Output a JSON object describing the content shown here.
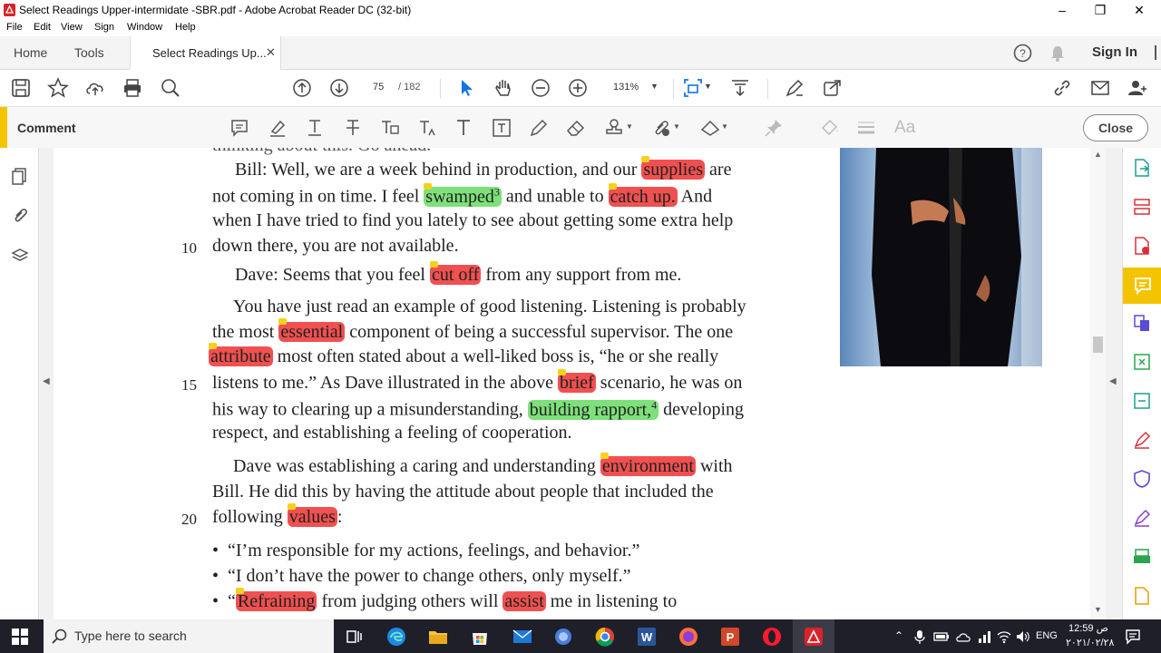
{
  "window": {
    "title": "Select Readings Upper-intermidate -SBR.pdf - Adobe Acrobat Reader DC (32-bit)"
  },
  "menu": [
    "File",
    "Edit",
    "View",
    "Sign",
    "Window",
    "Help"
  ],
  "tabs": {
    "home": "Home",
    "tools": "Tools",
    "document": "Select Readings Up..."
  },
  "header": {
    "sign_in": "Sign In"
  },
  "toolbar": {
    "page_current": "75",
    "page_total": "/ 182",
    "zoom": "131%"
  },
  "comment_bar": {
    "label": "Comment",
    "close": "Close",
    "text_tool": "Aa"
  },
  "document": {
    "line_numbers": {
      "l10": "10",
      "l15": "15",
      "l20": "20"
    },
    "p1": {
      "a": "Bill:  Well, we are a week behind in production, and our ",
      "a_hl": "supplies",
      "a2": " are",
      "b": "not coming in on time. I feel ",
      "b_hl": "swamped",
      "b_sup": "3",
      "b2": " and unable to ",
      "b_hl2": "catch up.",
      "b3": " And",
      "c": "when I have tried to find you lately to see about getting some extra help",
      "d": "down there, you are not available."
    },
    "p2": {
      "a": "Dave:  Seems that you feel ",
      "hl": "cut off",
      "b": " from any support from me."
    },
    "p3": {
      "a": "You have just read an example of good listening. Listening is probably",
      "b": "the most ",
      "b_hl": "essential",
      "b2": " component of being a successful supervisor. The one",
      "c_hl": "attribute",
      "c": " most often stated about a well-liked boss is, “he or she really",
      "d": "listens to me.” As Dave illustrated in the above ",
      "d_hl": "brief",
      "d2": " scenario, he was on",
      "e": "his way to clearing up a misunderstanding, ",
      "e_hl": "building rapport,",
      "e_sup": "4",
      "e2": " developing",
      "f": "respect, and establishing a feeling of cooperation."
    },
    "p4": {
      "a": "Dave was establishing a caring and understanding ",
      "a_hl": "environment",
      "a2": " with",
      "b": "Bill. He did this by having the attitude about people that included the",
      "c": "following ",
      "c_hl": "values",
      "c2": ":"
    },
    "bullets": {
      "b1": "“I’m responsible for my actions, feelings, and behavior.”",
      "b2": "“I don’t have the power to change others, only myself.”",
      "b3_pre": "“",
      "b3_hl": "Refraining",
      "b3_mid": " from judging others will ",
      "b3_hl2": "assist",
      "b3_end": " me in listening to"
    }
  },
  "taskbar": {
    "search_placeholder": "Type here to search",
    "time": "12:59 ص",
    "date": "٢٠٢١/٠٢/٢٨",
    "lang": "ENG"
  },
  "colors": {
    "highlight_red": "#f05050",
    "highlight_green": "#7de07a",
    "accent": "#f5c400"
  }
}
